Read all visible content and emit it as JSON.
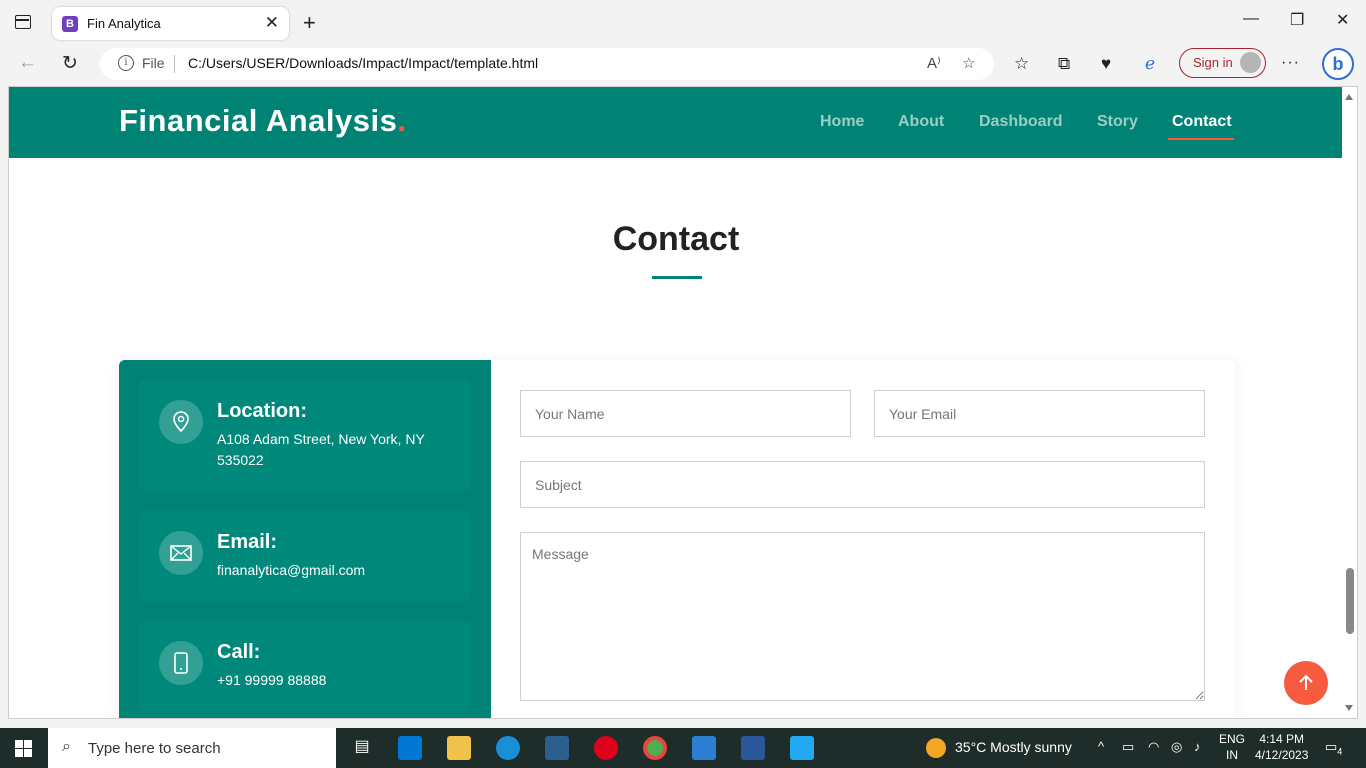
{
  "browser": {
    "tab_title": "Fin Analytica",
    "tab_favicon": "B",
    "address_scheme": "File",
    "url": "C:/Users/USER/Downloads/Impact/Impact/template.html",
    "sign_in": "Sign in"
  },
  "site": {
    "logo": "Financial Analysis",
    "logo_dot": ".",
    "nav": [
      "Home",
      "About",
      "Dashboard",
      "Story",
      "Contact"
    ],
    "active_nav": "Contact",
    "accent": "#008374",
    "accent_red": "#f85a40"
  },
  "contact": {
    "title": "Contact",
    "location_heading": "Location:",
    "location_text": "A108 Adam Street, New York, NY 535022",
    "email_heading": "Email:",
    "email_text": "finanalytica@gmail.com",
    "call_heading": "Call:",
    "call_text": "+91 99999 88888",
    "form": {
      "name_placeholder": "Your Name",
      "email_placeholder": "Your Email",
      "subject_placeholder": "Subject",
      "message_placeholder": "Message"
    }
  },
  "taskbar": {
    "search_placeholder": "Type here to search",
    "weather": "35°C  Mostly sunny",
    "lang_1": "ENG",
    "lang_2": "IN",
    "time": "4:14 PM",
    "date": "4/12/2023",
    "notifications": "4"
  }
}
